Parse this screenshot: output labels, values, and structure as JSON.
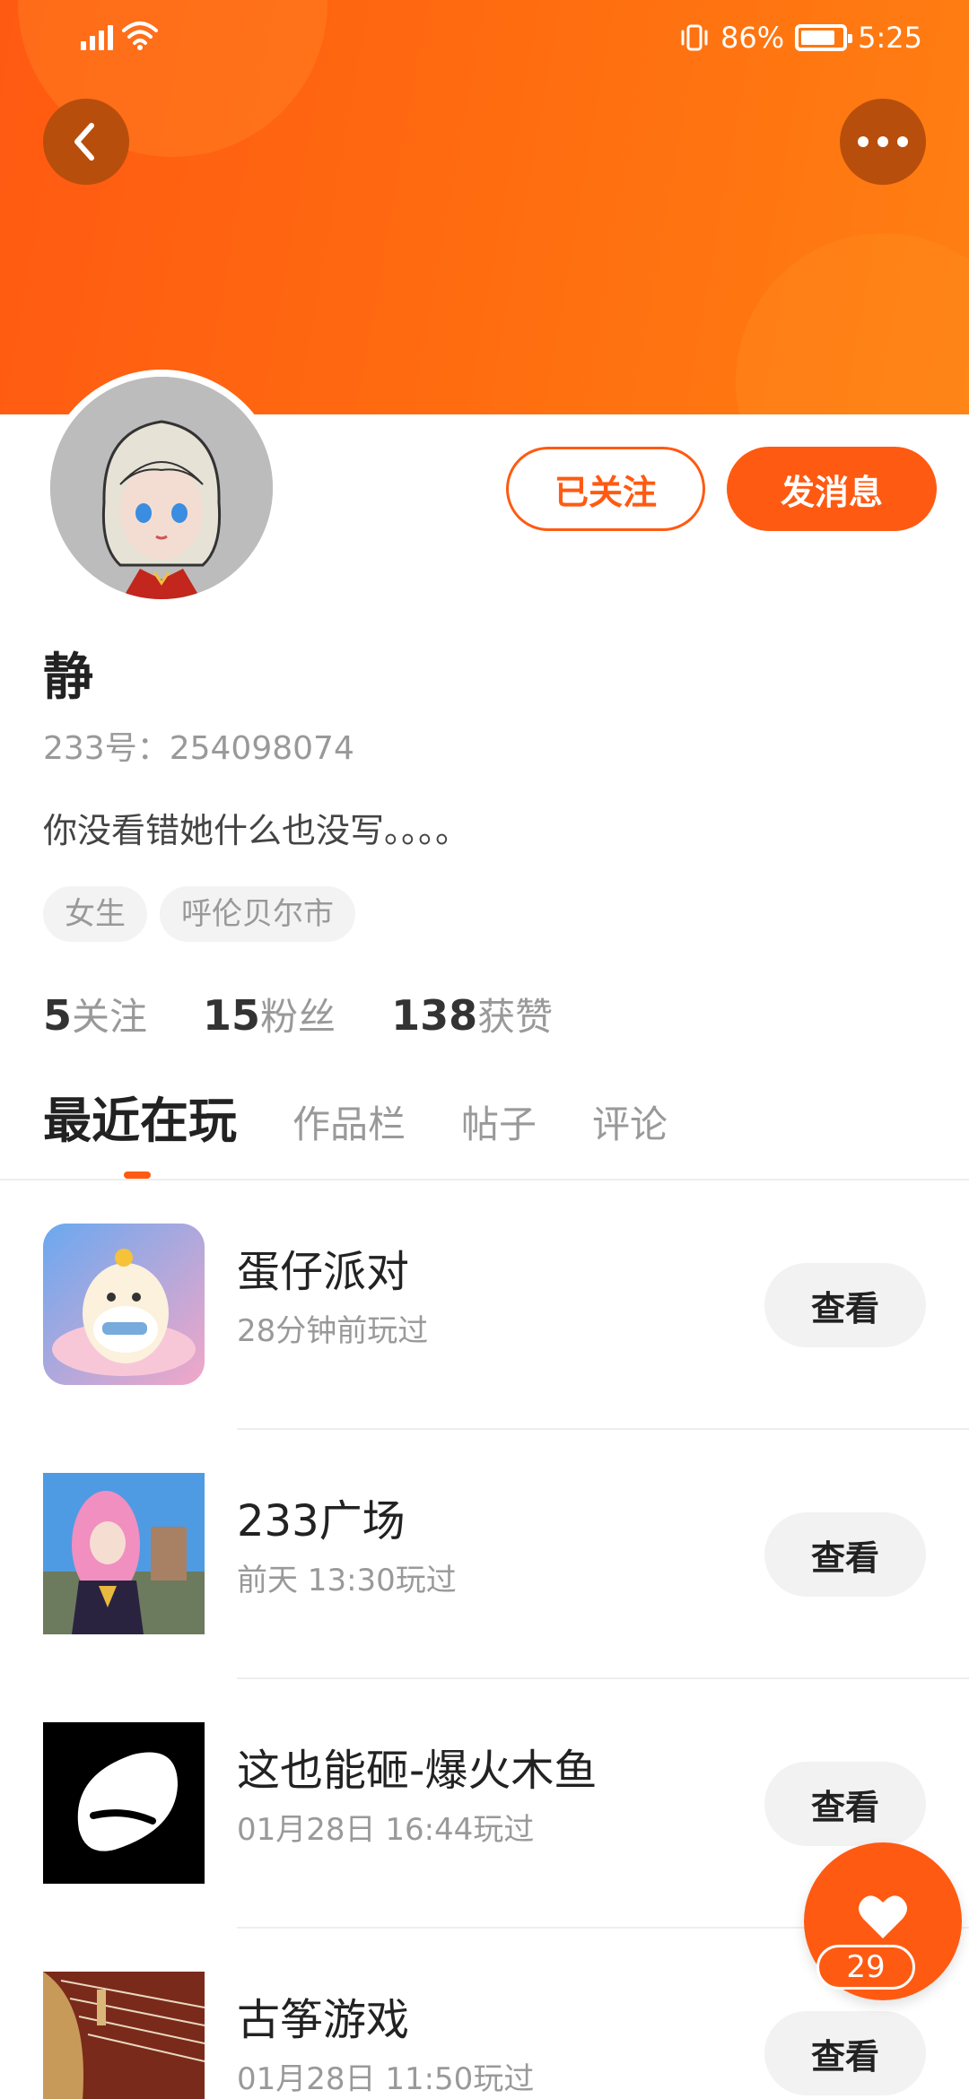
{
  "status_bar": {
    "network": "4G",
    "battery": "86%",
    "battery_level": 0.86,
    "time": "5:25"
  },
  "header": {
    "back_icon": "chevron-left-icon",
    "more_icon": "more-horizontal-icon",
    "banner_color": "#ff5a12"
  },
  "profile": {
    "name": "静",
    "uid": "233号：254098074",
    "bio": "你没看错她什么也没写。。。。",
    "tags": [
      "女生",
      "呼伦贝尔市"
    ],
    "follow_label": "已关注",
    "message_label": "发消息"
  },
  "stats": [
    {
      "value": "5",
      "label": "关注"
    },
    {
      "value": "15",
      "label": "粉丝"
    },
    {
      "value": "138",
      "label": "获赞"
    }
  ],
  "tabs": [
    "最近在玩",
    "作品栏",
    "帖子",
    "评论"
  ],
  "games": [
    {
      "title": "蛋仔派对",
      "played": "28分钟前玩过",
      "button": "查看"
    },
    {
      "title": "233广场",
      "played": "前天 13:30玩过",
      "button": "查看"
    },
    {
      "title": "这也能砸-爆火木鱼",
      "played": "01月28日 16:44玩过",
      "button": "查看"
    },
    {
      "title": "古筝游戏",
      "played": "01月28日 11:50玩过",
      "button": "查看"
    }
  ],
  "like_fab": {
    "icon": "heart-icon",
    "count": "29"
  },
  "accent_color": "#ff5a12"
}
